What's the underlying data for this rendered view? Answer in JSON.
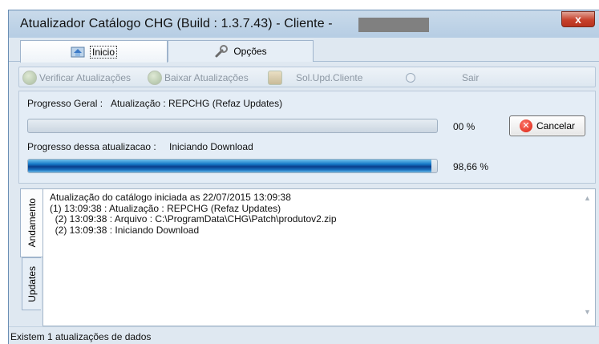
{
  "window": {
    "title": "Atualizador Catálogo CHG  (Build : 1.3.7.43) - Cliente -",
    "close_label": "x"
  },
  "tabs": [
    {
      "label": "Inicio",
      "icon": "home-icon",
      "active": true
    },
    {
      "label": "Opções",
      "icon": "wrench-icon",
      "active": false
    }
  ],
  "toolbar": {
    "verificar": "Verificar Atualizações",
    "baixar": "Baixar Atualizações",
    "solupd": "Sol.Upd.Cliente",
    "sair": "Sair"
  },
  "progress": {
    "geral_label": "Progresso Geral :",
    "geral_status": "Atualização : REPCHG (Refaz Updates)",
    "geral_pct_text": "00 %",
    "geral_fraction": 0.0,
    "atual_label": "Progresso dessa atualizacao :",
    "atual_status": "Iniciando Download",
    "atual_pct_text": "98,66 %",
    "atual_fraction": 0.9866,
    "cancel_label": "Cancelar"
  },
  "side_tabs": [
    {
      "label": "Andamento",
      "active": true
    },
    {
      "label": "Updates",
      "active": false
    }
  ],
  "log": [
    "Atualização do catálogo iniciada as 22/07/2015 13:09:38",
    "(1) 13:09:38 : Atualização : REPCHG (Refaz Updates)",
    "  (2) 13:09:38 : Arquivo : C:\\ProgramData\\CHG\\Patch\\produtov2.zip",
    "  (2) 13:09:38 : Iniciando Download"
  ],
  "status": "Existem 1 atualizações de dados",
  "colors": {
    "progress_fill": "#0a3e8c",
    "cancel_icon": "#d81e0e",
    "close_button": "#c7412b"
  }
}
